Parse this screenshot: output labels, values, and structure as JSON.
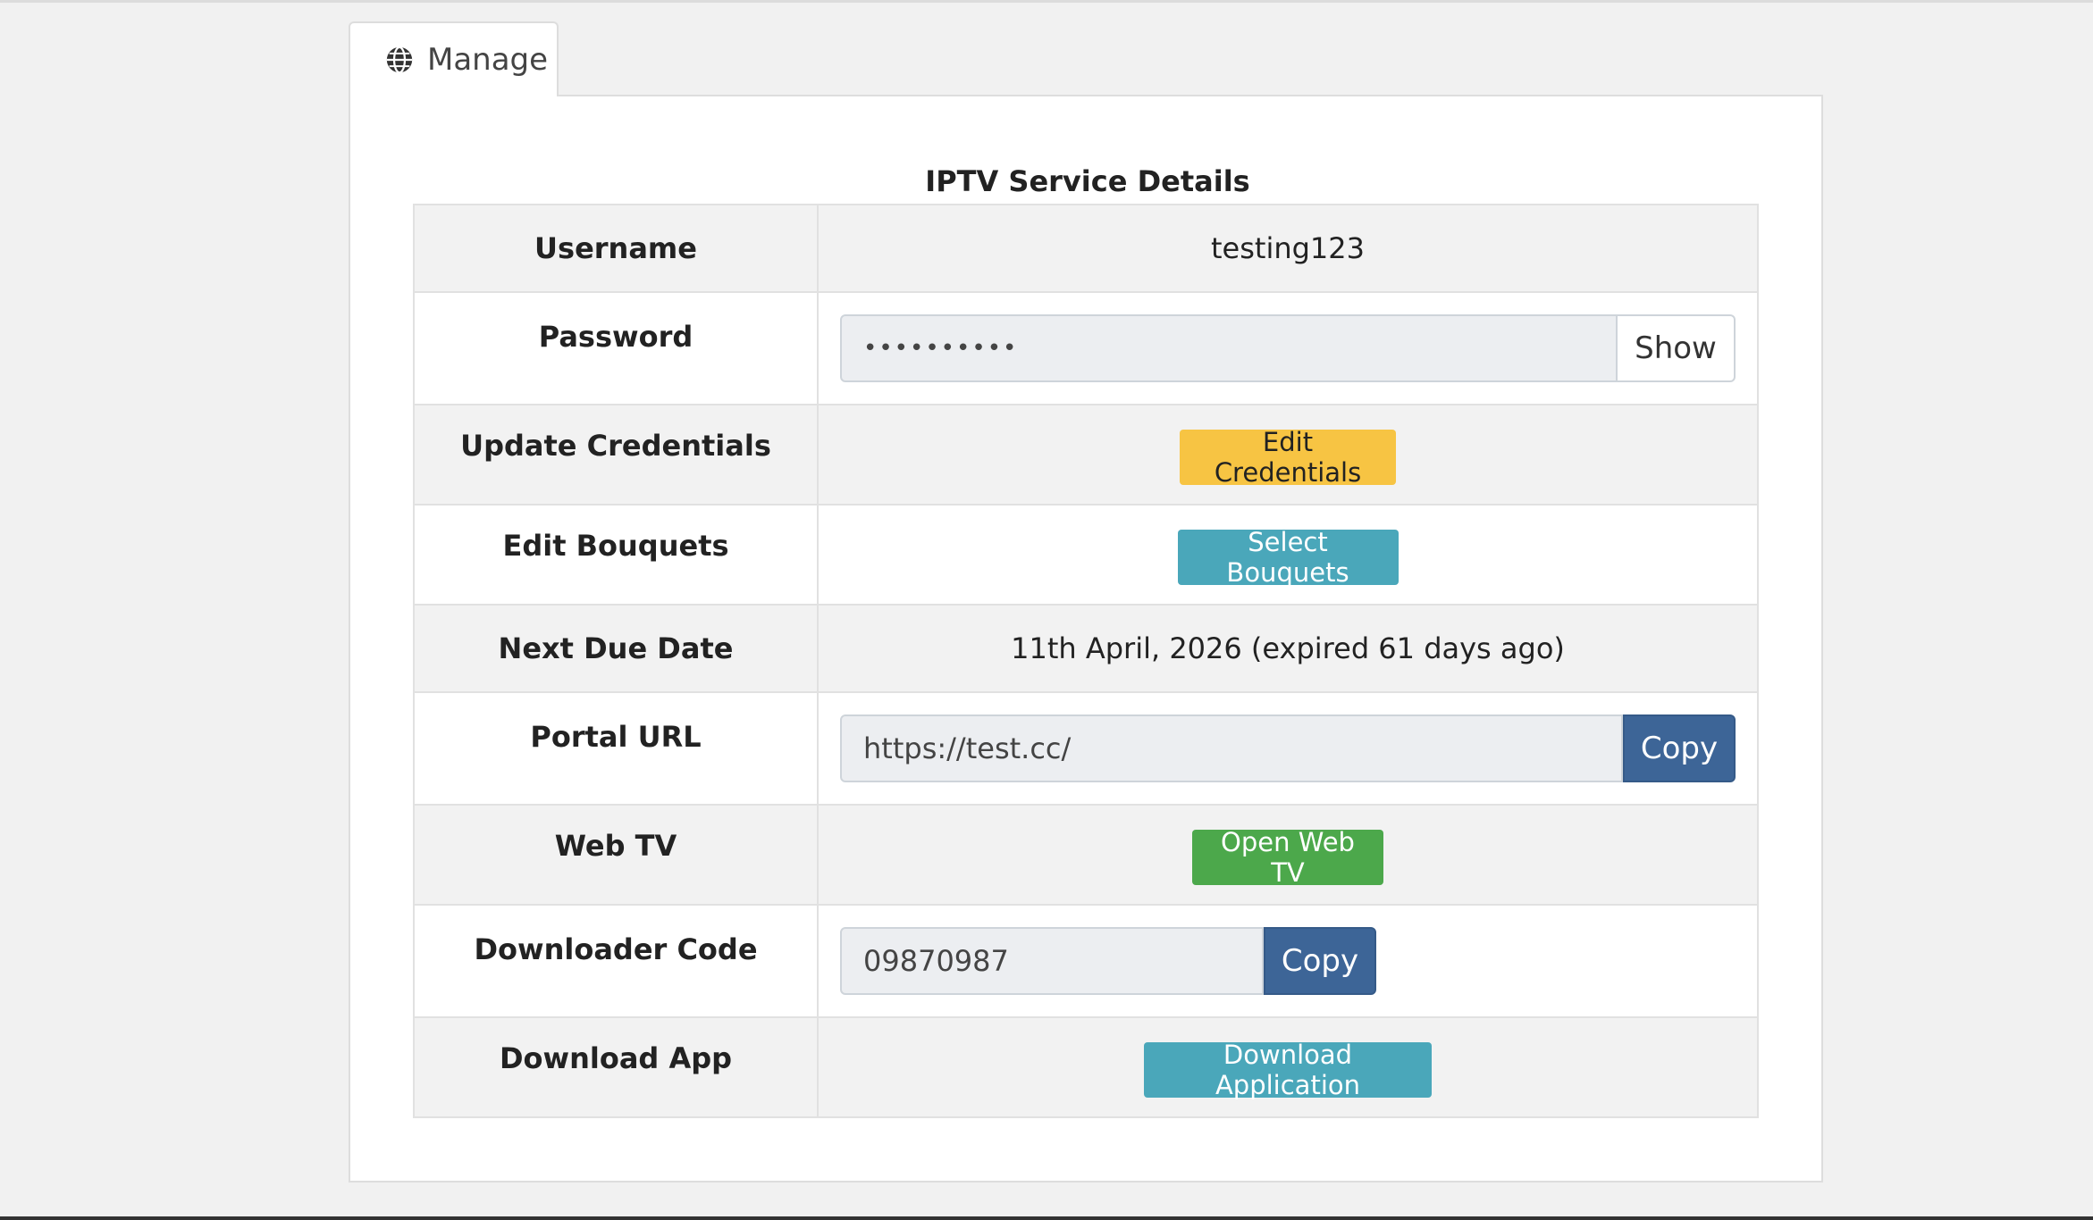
{
  "tab": {
    "label": "Manage",
    "icon": "globe-icon"
  },
  "title": "IPTV Service Details",
  "rows": {
    "username": {
      "label": "Username",
      "value": "testing123"
    },
    "password": {
      "label": "Password",
      "value": "••••••••••",
      "button": "Show"
    },
    "credentials": {
      "label": "Update Credentials",
      "button": "Edit Credentials"
    },
    "bouquets": {
      "label": "Edit Bouquets",
      "button": "Select Bouquets"
    },
    "due": {
      "label": "Next Due Date",
      "value": "11th April, 2026 (expired 61 days ago)"
    },
    "portal": {
      "label": "Portal URL",
      "value": "https://test.cc/",
      "button": "Copy"
    },
    "webtv": {
      "label": "Web TV",
      "button": "Open Web TV"
    },
    "downloader": {
      "label": "Downloader Code",
      "value": "09870987",
      "button": "Copy"
    },
    "app": {
      "label": "Download App",
      "button": "Download Application"
    }
  },
  "colors": {
    "warning": "#f7c443",
    "info": "#4aa7ba",
    "success": "#4ca84b",
    "primary": "#3d6597"
  }
}
